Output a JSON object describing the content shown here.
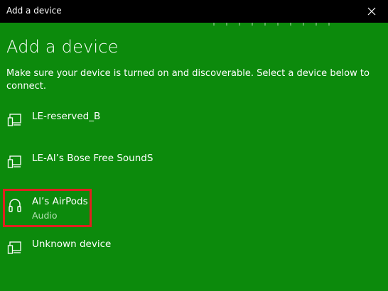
{
  "window": {
    "title": "Add a device",
    "close_icon": "close-icon"
  },
  "main": {
    "heading": "Add a device",
    "instructions": "Make sure your device is turned on and discoverable. Select a device below to connect."
  },
  "devices": [
    {
      "name": "LE-reserved_B",
      "subtitle": "",
      "icon": "device-generic-icon"
    },
    {
      "name": "LE-Al’s Bose Free SoundS",
      "subtitle": "",
      "icon": "device-generic-icon"
    },
    {
      "name": "Al’s AirPods",
      "subtitle": "Audio",
      "icon": "headphones-icon",
      "highlighted": true
    },
    {
      "name": "Unknown device",
      "subtitle": "",
      "icon": "device-generic-icon"
    }
  ],
  "colors": {
    "background": "#0c8a0c",
    "titlebar": "#000000",
    "highlight": "#e02020"
  }
}
